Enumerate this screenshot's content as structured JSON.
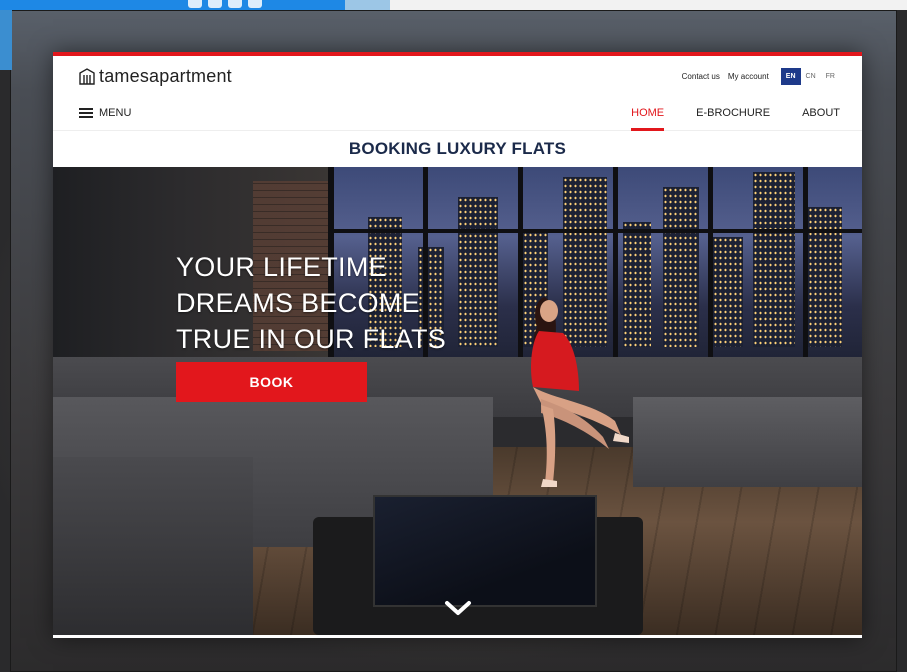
{
  "site": {
    "logo_text": "tamesapartment",
    "contact_label": "Contact us",
    "account_label": "My account",
    "languages": [
      "EN",
      "CN",
      "FR"
    ],
    "active_language": "EN"
  },
  "nav": {
    "menu_label": "MENU",
    "links": [
      "HOME",
      "E-BROCHURE",
      "ABOUT"
    ],
    "active_link": "HOME"
  },
  "title_bar": "BOOKING LUXURY FLATS",
  "hero": {
    "headline_lines": [
      "YOUR LIFETIME",
      "DREAMS BECOME",
      "TRUE IN OUR FLATS"
    ],
    "book_button": "BOOK"
  },
  "colors": {
    "accent_red": "#e2171c",
    "navy": "#1b2a4a",
    "lang_active_bg": "#1e3a8a"
  },
  "icons": [
    "building-logo-icon",
    "hamburger-icon",
    "chevron-down-icon",
    "social-icon"
  ]
}
